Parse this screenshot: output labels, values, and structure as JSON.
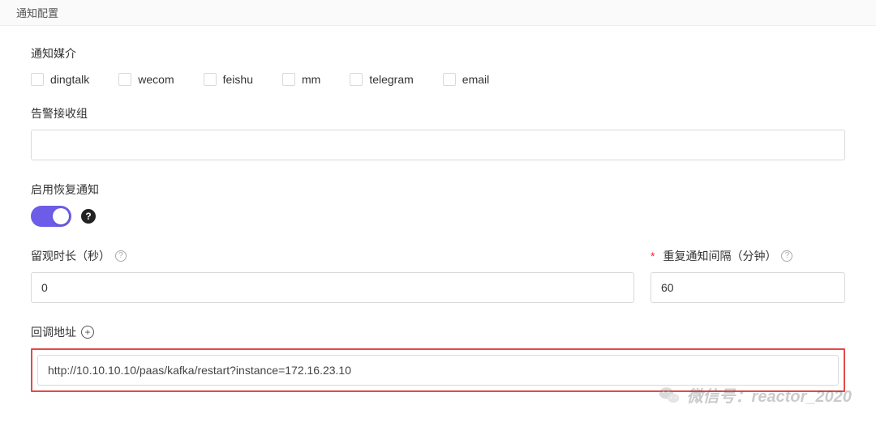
{
  "page_title": "通知配置",
  "media": {
    "label": "通知媒介",
    "options": [
      {
        "key": "dingtalk",
        "label": "dingtalk"
      },
      {
        "key": "wecom",
        "label": "wecom"
      },
      {
        "key": "feishu",
        "label": "feishu"
      },
      {
        "key": "mm",
        "label": "mm"
      },
      {
        "key": "telegram",
        "label": "telegram"
      },
      {
        "key": "email",
        "label": "email"
      }
    ]
  },
  "receiver_group": {
    "label": "告警接收组",
    "value": ""
  },
  "recovery_notify": {
    "label": "启用恢复通知",
    "enabled": true
  },
  "observe_duration": {
    "label": "留观时长（秒）",
    "value": "0"
  },
  "repeat_interval": {
    "label": "重复通知间隔（分钟）",
    "value": "60"
  },
  "callback": {
    "label": "回调地址",
    "value": "http://10.10.10.10/paas/kafka/restart?instance=172.16.23.10"
  },
  "watermark": "微信号：reactor_2020"
}
